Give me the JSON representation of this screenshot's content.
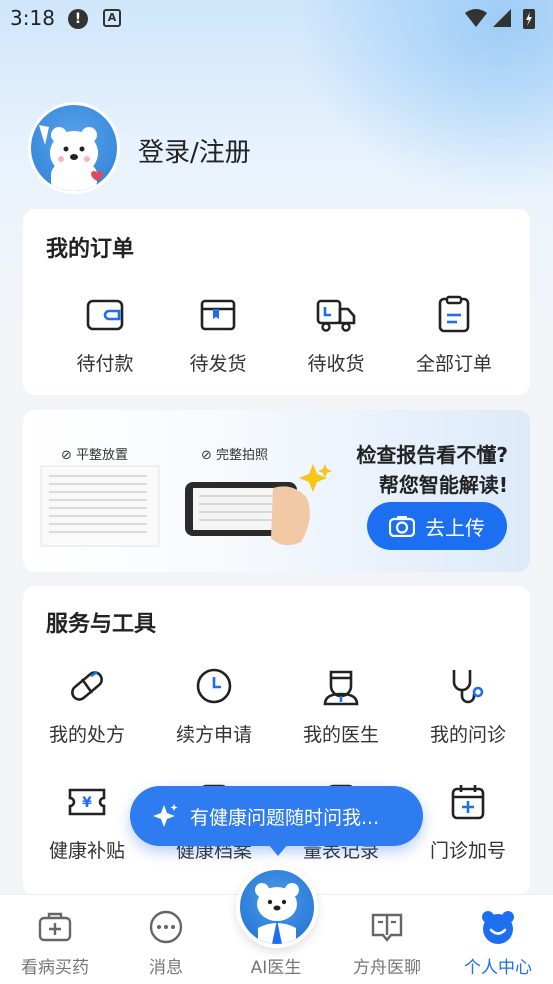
{
  "status_bar": {
    "time": "3:18",
    "icon_a": "!",
    "icon_b": "A"
  },
  "profile": {
    "login_label": "登录/注册"
  },
  "orders": {
    "title": "我的订单",
    "items": [
      {
        "label": "待付款",
        "icon": "wallet-icon"
      },
      {
        "label": "待发货",
        "icon": "box-icon"
      },
      {
        "label": "待收货",
        "icon": "truck-icon"
      },
      {
        "label": "全部订单",
        "icon": "clipboard-icon"
      }
    ]
  },
  "banner": {
    "tag_1": "平整放置",
    "tag_2": "完整拍照",
    "headline_line1": "检查报告看不懂?",
    "headline_line2": "帮您智能解读!",
    "upload_label": "去上传"
  },
  "services": {
    "title": "服务与工具",
    "items": [
      {
        "label": "我的处方",
        "icon": "pill-icon"
      },
      {
        "label": "续方申请",
        "icon": "clock-icon"
      },
      {
        "label": "我的医生",
        "icon": "doctor-icon"
      },
      {
        "label": "我的问诊",
        "icon": "stethoscope-icon"
      },
      {
        "label": "健康补贴",
        "icon": "yuan-ticket-icon"
      },
      {
        "label": "健康档案",
        "icon": "folder-icon"
      },
      {
        "label": "量表记录",
        "icon": "record-icon"
      },
      {
        "label": "门诊加号",
        "icon": "calendar-plus-icon"
      }
    ]
  },
  "ai_bubble": {
    "text": "有健康问题随时问我..."
  },
  "bottom_nav": {
    "items": [
      {
        "label": "看病买药",
        "icon": "medical-kit-icon",
        "active": false
      },
      {
        "label": "消息",
        "icon": "message-icon",
        "active": false
      },
      {
        "label": "AI医生",
        "icon": "ai-doctor-icon",
        "active": false
      },
      {
        "label": "方舟医聊",
        "icon": "chat-book-icon",
        "active": false
      },
      {
        "label": "个人中心",
        "icon": "bear-icon",
        "active": true
      }
    ]
  },
  "colors": {
    "accent": "#1d6ff2",
    "bubble": "#2f7cf0",
    "card_bg": "#ffffff",
    "page_bg": "#f2f4f7"
  }
}
